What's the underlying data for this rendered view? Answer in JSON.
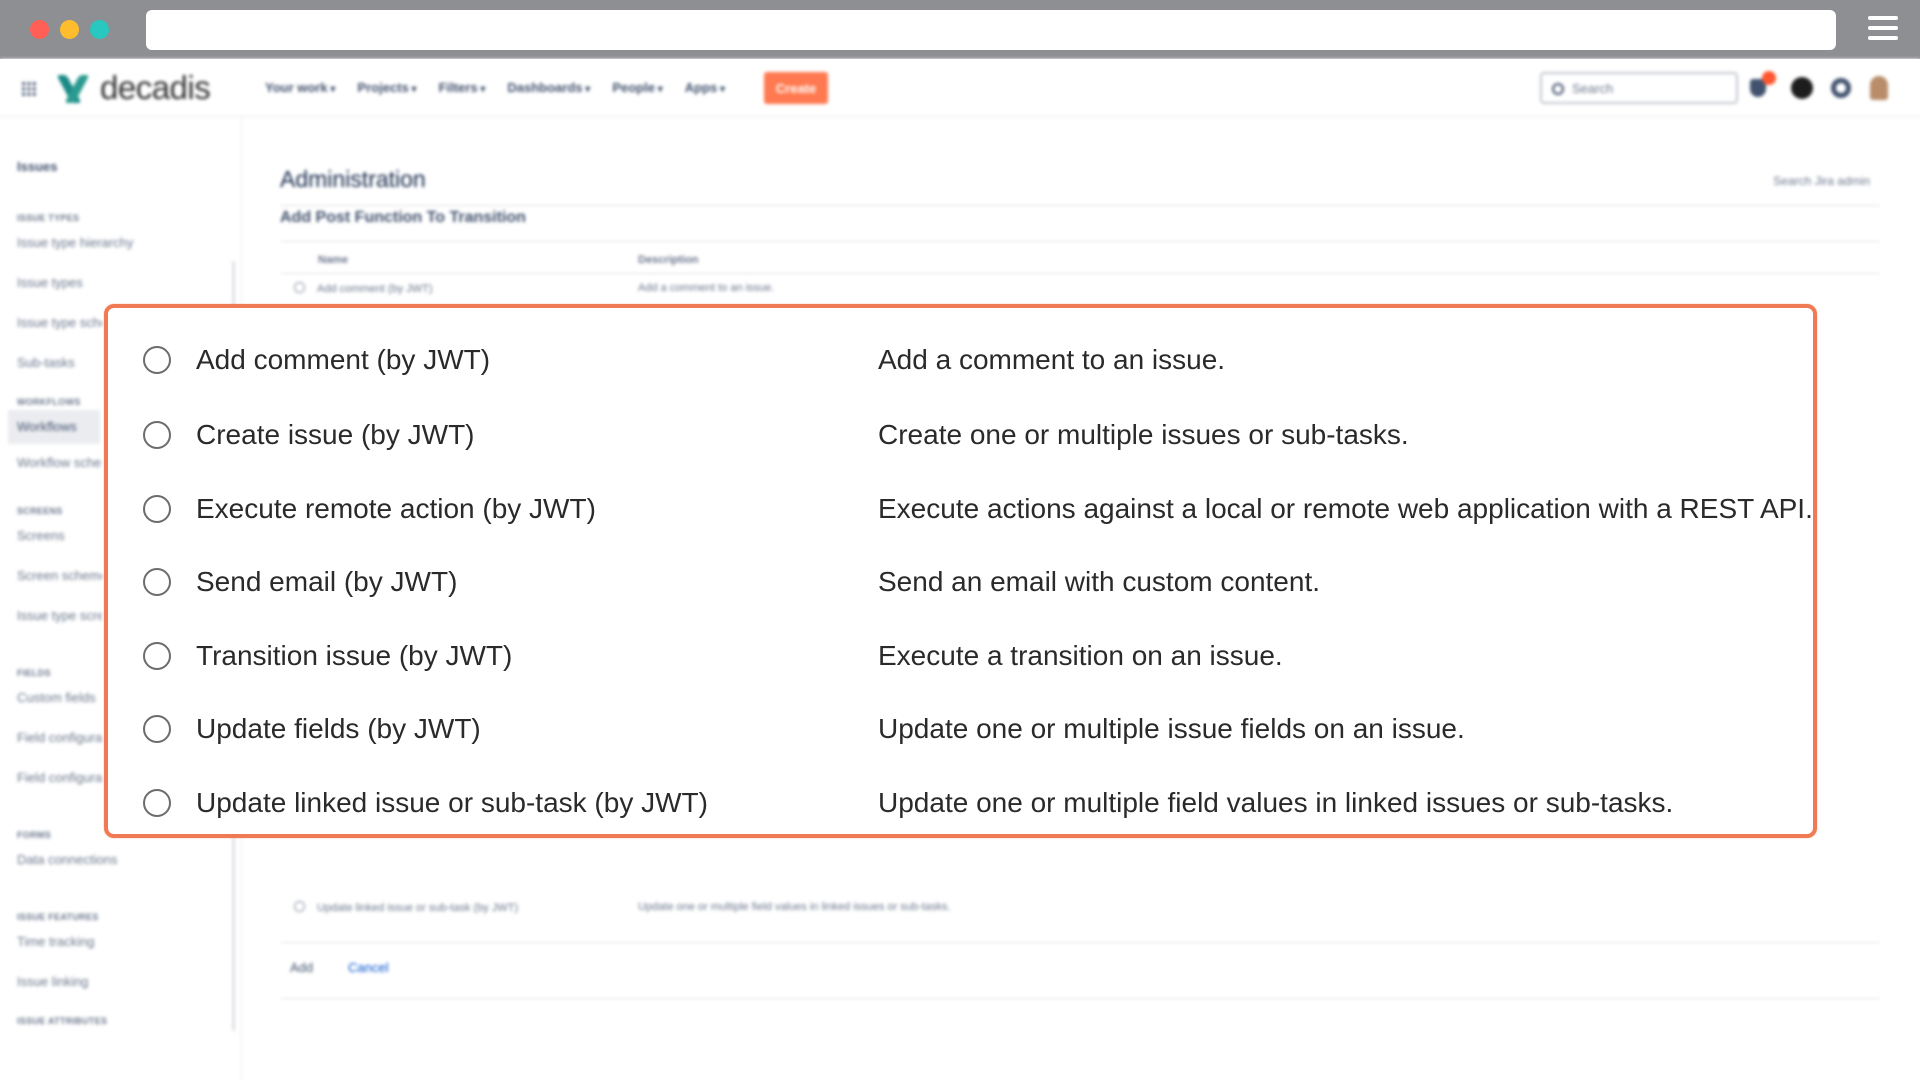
{
  "browser": {
    "window_controls": [
      "close",
      "minimize",
      "maximize"
    ],
    "menu_icon": "hamburger-icon"
  },
  "topnav": {
    "brand": "decadis",
    "items": [
      "Your work",
      "Projects",
      "Filters",
      "Dashboards",
      "People",
      "Apps"
    ],
    "create_label": "Create",
    "search_placeholder": "Search",
    "accent_color": "#ff7a50"
  },
  "sidebar": {
    "title": "Issues",
    "sections": [
      {
        "heading": "ISSUE TYPES",
        "items": [
          "Issue type hierarchy",
          "Issue types",
          "Issue type schemes",
          "Sub-tasks"
        ]
      },
      {
        "heading": "WORKFLOWS",
        "items": [
          "Workflows",
          "Workflow schemes"
        ]
      },
      {
        "heading": "SCREENS",
        "items": [
          "Screens",
          "Screen schemes",
          "Issue type screen schemes"
        ]
      },
      {
        "heading": "FIELDS",
        "items": [
          "Custom fields",
          "Field configurations",
          "Field configuration schemes"
        ]
      },
      {
        "heading": "FORMS",
        "items": [
          "Data connections"
        ]
      },
      {
        "heading": "ISSUE FEATURES",
        "items": [
          "Time tracking",
          "Issue linking"
        ]
      },
      {
        "heading": "ISSUE ATTRIBUTES",
        "items": []
      }
    ],
    "active_item": "Workflows"
  },
  "main": {
    "title": "Administration",
    "admin_search": "Search Jira admin",
    "subtitle": "Add Post Function To Transition",
    "columns": {
      "name": "Name",
      "description": "Description"
    },
    "first_row": {
      "name": "Add comment (by JWT)",
      "description": "Add a comment to an issue."
    },
    "last_row": {
      "name": "Update linked issue or sub-task (by JWT)",
      "description": "Update one or multiple field values in linked issues or sub-tasks."
    },
    "add_label": "Add",
    "cancel_label": "Cancel"
  },
  "callout": {
    "border_color": "#f07a53",
    "options": [
      {
        "name": "Add comment (by JWT)",
        "description": "Add a comment to an issue."
      },
      {
        "name": "Create issue (by JWT)",
        "description": "Create one or multiple issues or sub-tasks."
      },
      {
        "name": "Execute remote action (by JWT)",
        "description": "Execute actions against a local or remote web application with a REST API."
      },
      {
        "name": "Send email (by JWT)",
        "description": "Send an email with custom content."
      },
      {
        "name": "Transition issue (by JWT)",
        "description": "Execute a transition on an issue."
      },
      {
        "name": "Update fields (by JWT)",
        "description": "Update one or multiple issue fields on an issue."
      },
      {
        "name": "Update linked issue or sub-task (by JWT)",
        "description": "Update one or multiple field values in linked issues or sub-tasks."
      }
    ]
  }
}
